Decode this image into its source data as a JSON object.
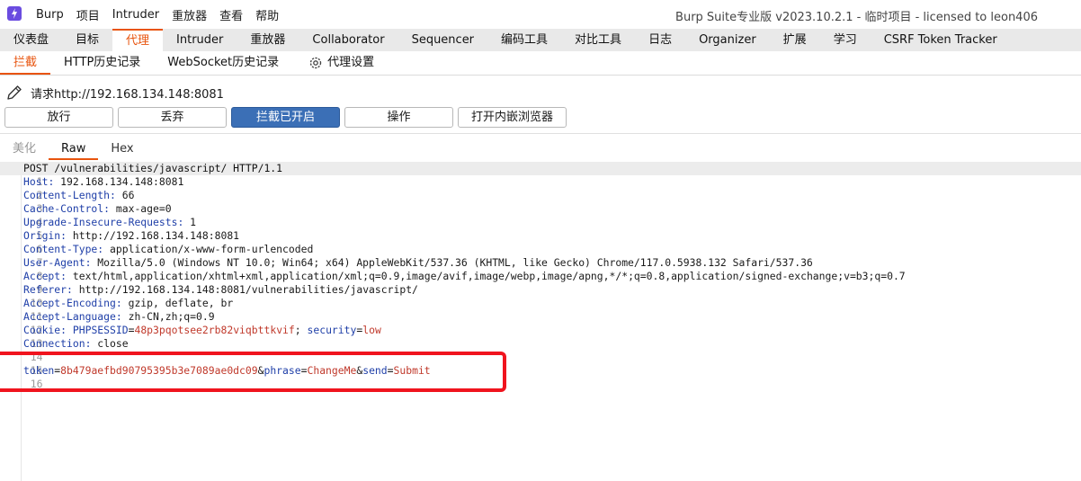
{
  "app": {
    "menu": [
      "Burp",
      "项目",
      "Intruder",
      "重放器",
      "查看",
      "帮助"
    ],
    "title": "Burp Suite专业版  v2023.10.2.1 - 临时项目 - licensed to leon406"
  },
  "main_tabs": [
    "仪表盘",
    "目标",
    "代理",
    "Intruder",
    "重放器",
    "Collaborator",
    "Sequencer",
    "编码工具",
    "对比工具",
    "日志",
    "Organizer",
    "扩展",
    "学习",
    "CSRF Token Tracker"
  ],
  "sub_tabs": {
    "intercept": "拦截",
    "http_history": "HTTP历史记录",
    "websocket_history": "WebSocket历史记录",
    "proxy_settings": "代理设置"
  },
  "request_target": "请求http://192.168.134.148:8081",
  "toolbar": {
    "forward": "放行",
    "drop": "丢弃",
    "intercept_on": "拦截已开启",
    "action": "操作",
    "open_browser": "打开内嵌浏览器"
  },
  "view_tabs": {
    "pretty": "美化",
    "raw": "Raw",
    "hex": "Hex"
  },
  "request": {
    "line1": "POST /vulnerabilities/javascript/ HTTP/1.1",
    "headers": [
      {
        "name": "Host",
        "value": " 192.168.134.148:8081"
      },
      {
        "name": "Content-Length",
        "value": " 66"
      },
      {
        "name": "Cache-Control",
        "value": " max-age=0"
      },
      {
        "name": "Upgrade-Insecure-Requests",
        "value": " 1"
      },
      {
        "name": "Origin",
        "value": " http://192.168.134.148:8081"
      },
      {
        "name": "Content-Type",
        "value": " application/x-www-form-urlencoded"
      },
      {
        "name": "User-Agent",
        "value": " Mozilla/5.0 (Windows NT 10.0; Win64; x64) AppleWebKit/537.36 (KHTML, like Gecko) Chrome/117.0.5938.132 Safari/537.36"
      },
      {
        "name": "Accept",
        "value": " text/html,application/xhtml+xml,application/xml;q=0.9,image/avif,image/webp,image/apng,*/*;q=0.8,application/signed-exchange;v=b3;q=0.7"
      },
      {
        "name": "Referer",
        "value": " http://192.168.134.148:8081/vulnerabilities/javascript/"
      },
      {
        "name": "Accept-Encoding",
        "value": " gzip, deflate, br"
      },
      {
        "name": "Accept-Language",
        "value": " zh-CN,zh;q=0.9"
      }
    ],
    "cookie": {
      "name": "Cookie",
      "k1": "PHPSESSID",
      "v1": "48p3pqotsee2rb82viqbttkvif",
      "sep": "; ",
      "k2": "security",
      "v2": "low"
    },
    "connection": {
      "name": "Connection",
      "value": " close"
    },
    "body": {
      "k1": "token",
      "v1": "8b479aefbd90795395b3e7089ae0dc09",
      "k2": "phrase",
      "v2": "ChangeMe",
      "k3": "send",
      "v3": "Submit"
    },
    "line_numbers": [
      "1",
      "2",
      "3",
      "4",
      "5",
      "6",
      "7",
      "8",
      "9",
      "10",
      "11",
      "12",
      "13",
      "14",
      "15",
      "16"
    ]
  },
  "colors": {
    "accent": "#e8540e",
    "primary_button": "#3b6fb6",
    "highlight": "#f0141e"
  }
}
